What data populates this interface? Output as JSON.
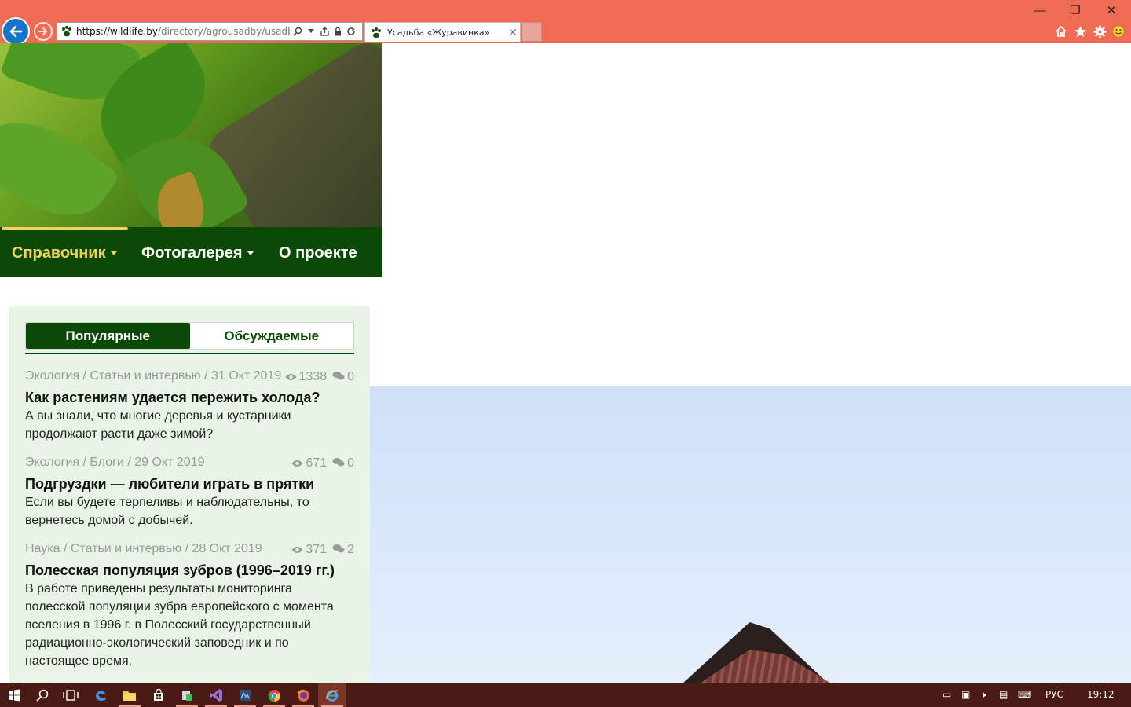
{
  "browser": {
    "url_host": "https://wildlife.by",
    "url_path": "/directory/agrousadby/usadba-zh",
    "tab_title": "Усадьба «Журавинка»",
    "colors": {
      "chrome": "#f06b54",
      "back_button": "#1a73c9"
    },
    "icons": [
      "back-arrow-icon",
      "forward-arrow-icon",
      "paw-icon",
      "search-icon",
      "dropdown-icon",
      "bookmark-icon",
      "lock-icon",
      "refresh-icon",
      "close-icon",
      "home-icon",
      "star-icon",
      "gear-icon",
      "smiley-icon"
    ]
  },
  "window_controls": {
    "minimize": "—",
    "restore": "❐",
    "close": "✕"
  },
  "nav": {
    "items": [
      {
        "label": "Справочник",
        "dropdown": true,
        "active": true
      },
      {
        "label": "Фотогалерея",
        "dropdown": true,
        "active": false
      },
      {
        "label": "О проекте",
        "dropdown": false,
        "active": false
      }
    ],
    "colors": {
      "bar": "#0b4a06",
      "active": "#f2d05a"
    }
  },
  "widget": {
    "tabs": [
      {
        "label": "Популярные",
        "active": true
      },
      {
        "label": "Обсуждаемые",
        "active": false
      }
    ],
    "articles": [
      {
        "meta": "Экология / Статьи и интервью / 31 Окт 2019",
        "views": "1338",
        "comments": "0",
        "title": "Как растениям удается пережить холода?",
        "excerpt": "А вы знали, что многие деревья и кустарники продолжают расти даже зимой?"
      },
      {
        "meta": "Экология / Блоги / 29 Окт 2019",
        "views": "671",
        "comments": "0",
        "title": "Подгруздки — любители играть в прятки",
        "excerpt": "Если вы будете терпеливы и наблюдательны, то вернетесь домой с добычей."
      },
      {
        "meta": "Наука / Статьи и интервью / 28 Окт 2019",
        "views": "371",
        "comments": "2",
        "title": "Полесская популяция зубров (1996–2019 гг.)",
        "excerpt": "В работе приведены результаты мониторинга полесской популяции зубра европейского с момента вселения в 1996 г. в Полесский государственный радиационно-экологический заповедник и по настоящее время."
      }
    ]
  },
  "taskbar": {
    "language": "РУС",
    "time": "19:12",
    "apps": [
      "windows-start-icon",
      "search-icon",
      "task-view-icon",
      "edge-icon",
      "file-explorer-icon",
      "store-icon",
      "app-icon",
      "visual-studio-icon",
      "app-icon",
      "chrome-icon",
      "firefox-icon",
      "internet-explorer-icon"
    ]
  }
}
